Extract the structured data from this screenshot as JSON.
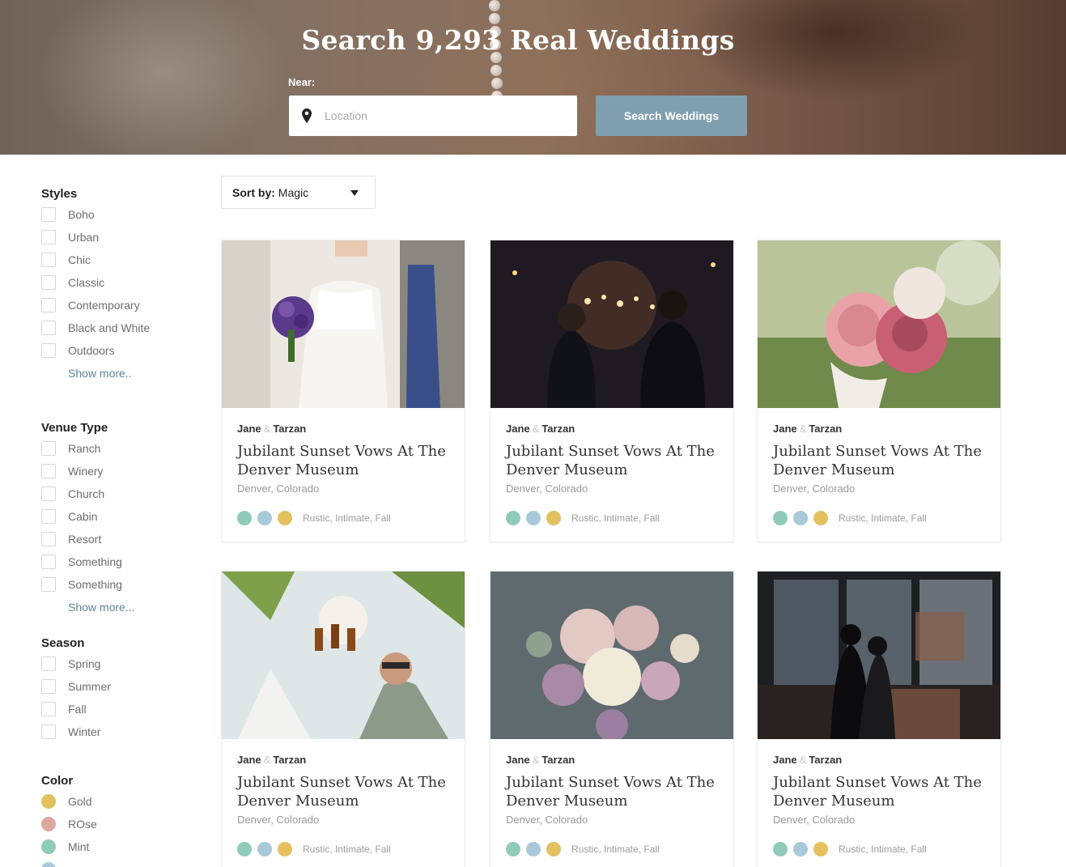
{
  "hero": {
    "title": "Search 9,293 Real Weddings",
    "near_label": "Near:",
    "location_placeholder": "Location",
    "search_button": "Search Weddings",
    "button_color": "#7f9fae"
  },
  "sort": {
    "prefix": "Sort by:",
    "value": "Magic"
  },
  "filters": {
    "styles": {
      "title": "Styles",
      "items": [
        "Boho",
        "Urban",
        "Chic",
        "Classic",
        "Contemporary",
        "Black and White",
        "Outdoors"
      ],
      "show_more": "Show more.."
    },
    "venue": {
      "title": "Venue Type",
      "items": [
        "Ranch",
        "Winery",
        "Church",
        "Cabin",
        "Resort",
        "Something",
        "Something"
      ],
      "show_more": "Show more..."
    },
    "season": {
      "title": "Season",
      "items": [
        "Spring",
        "Summer",
        "Fall",
        "Winter"
      ]
    },
    "color": {
      "title": "Color",
      "items": [
        {
          "label": "Gold",
          "color": "#e2c15e"
        },
        {
          "label": "ROse",
          "color": "#dea8a0"
        },
        {
          "label": "Mint",
          "color": "#8fcbb8"
        }
      ]
    }
  },
  "palette": [
    "#8fcbb8",
    "#a9c9da",
    "#e2c15e"
  ],
  "cards": [
    {
      "partner1": "Jane",
      "amp": "&",
      "partner2": "Tarzan",
      "title": "Jubilant Sunset Vows At The Denver Museum",
      "location": "Denver, Colorado",
      "tags": "Rustic,  Intimate, Fall",
      "photo": "bride-bouquet"
    },
    {
      "partner1": "Jane",
      "amp": "&",
      "partner2": "Tarzan",
      "title": "Jubilant Sunset Vows At The Denver Museum",
      "location": "Denver, Colorado",
      "tags": "Rustic,  Intimate, Fall",
      "photo": "sparklers"
    },
    {
      "partner1": "Jane",
      "amp": "&",
      "partner2": "Tarzan",
      "title": "Jubilant Sunset Vows At The Denver Museum",
      "location": "Denver, Colorado",
      "tags": "Rustic,  Intimate, Fall",
      "photo": "pink-roses"
    },
    {
      "partner1": "Jane",
      "amp": "&",
      "partner2": "Tarzan",
      "title": "Jubilant Sunset Vows At The Denver Museum",
      "location": "Denver, Colorado",
      "tags": "Rustic,  Intimate, Fall",
      "photo": "groomsmen-toast"
    },
    {
      "partner1": "Jane",
      "amp": "&",
      "partner2": "Tarzan",
      "title": "Jubilant Sunset Vows At The Denver Museum",
      "location": "Denver, Colorado",
      "tags": "Rustic,  Intimate, Fall",
      "photo": "flower-bouquet"
    },
    {
      "partner1": "Jane",
      "amp": "&",
      "partner2": "Tarzan",
      "title": "Jubilant Sunset Vows At The Denver Museum",
      "location": "Denver, Colorado",
      "tags": "Rustic,  Intimate, Fall",
      "photo": "couple-window"
    }
  ]
}
